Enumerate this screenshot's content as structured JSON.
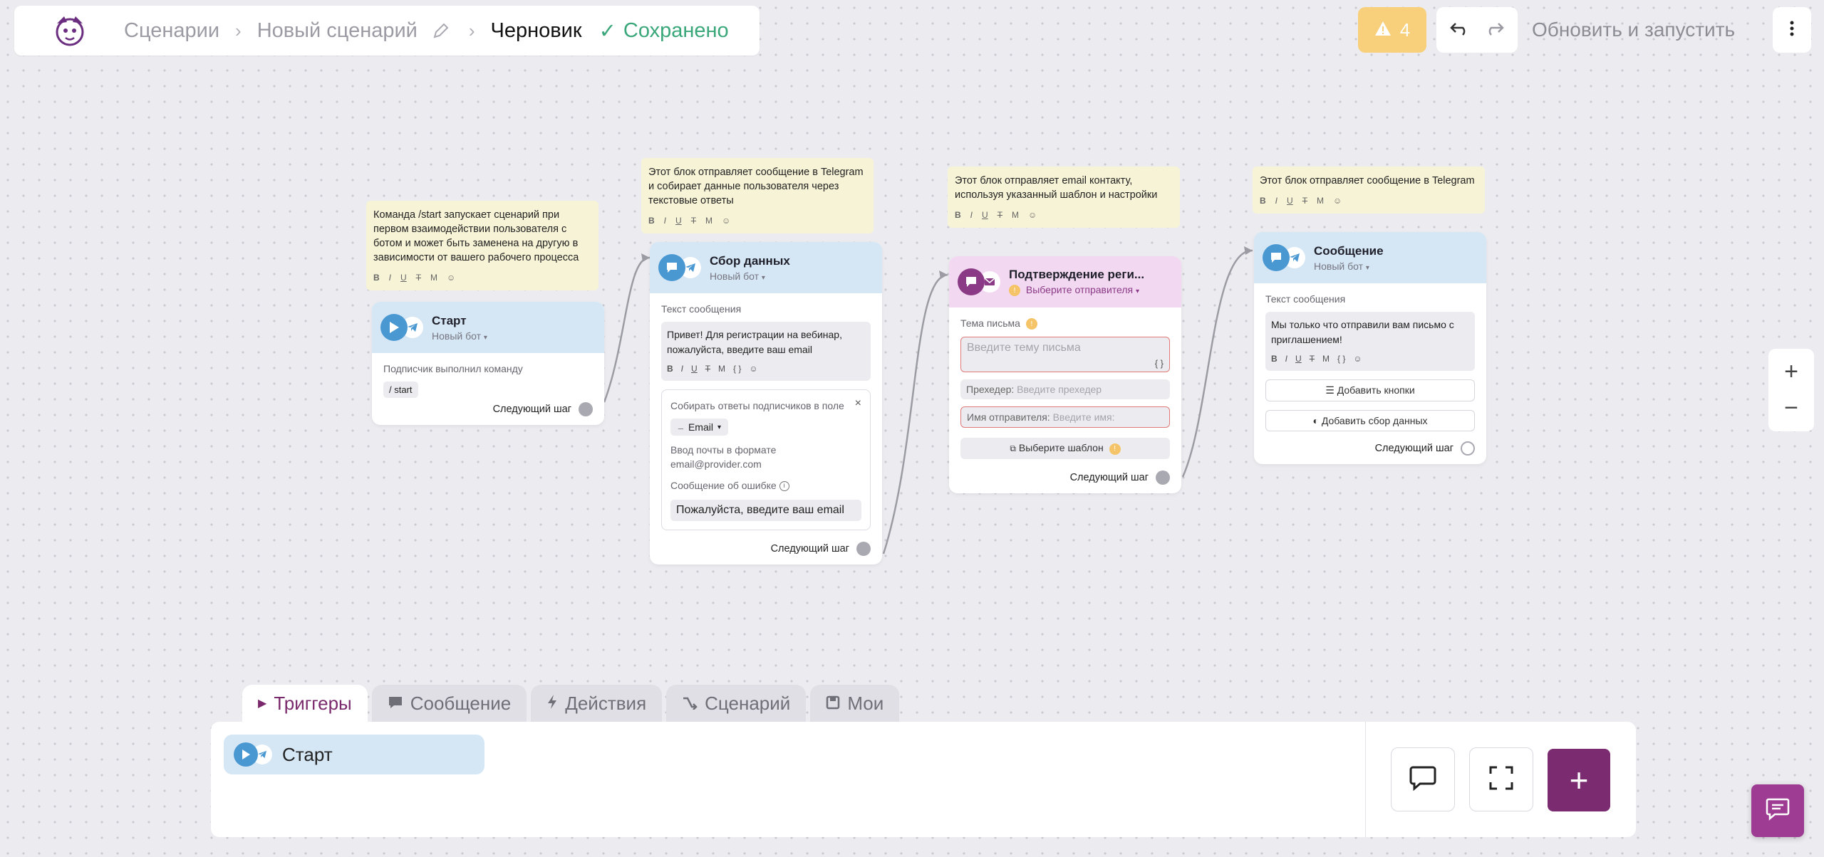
{
  "header": {
    "crumbs": [
      "Сценарии",
      "Новый сценарий"
    ],
    "status": "Черновик",
    "saved": "Сохранено",
    "warnings_count": "4",
    "update_button": "Обновить и запустить"
  },
  "notes": [
    "Команда /start запускает сценарий при первом взаимодействии пользователя с ботом и может быть заменена на другую в зависимости от вашего рабочего процесса",
    "Этот блок отправляет сообщение в Telegram и собирает данные пользователя через текстовые ответы",
    "Этот блок отправляет email контакту, используя указанный шаблон и настройки",
    "Этот блок отправляет сообщение в Telegram"
  ],
  "format_toolbar": [
    "B",
    "I",
    "U",
    "T",
    "M",
    "{ }",
    "☺"
  ],
  "nodes": {
    "start": {
      "title": "Старт",
      "bot": "Новый бот",
      "trigger_label": "Подписчик выполнил команду",
      "command": "/ start",
      "next": "Следующий шаг"
    },
    "collect": {
      "title": "Сбор данных",
      "bot": "Новый бот",
      "msg_label": "Текст сообщения",
      "msg": "Привет! Для регистрации на вебинар, пожалуйста, введите ваш email",
      "collect_label": "Собирать ответы подписчиков в поле",
      "field": "Email",
      "format_hint": "Ввод почты в формате email@provider.com",
      "error_label": "Сообщение об ошибке",
      "error_msg": "Пожалуйста, введите ваш email",
      "next": "Следующий шаг"
    },
    "email": {
      "title": "Подтверждение реги...",
      "sender_select": "Выберите отправителя",
      "subject_label": "Тема письма",
      "subject_placeholder": "Введите тему письма",
      "preheader_label": "Прехедер:",
      "preheader_placeholder": "Введите прехедер",
      "sender_label": "Имя отправителя:",
      "sender_placeholder": "Введите имя:",
      "template_button": "Выберите шаблон",
      "next": "Следующий шаг"
    },
    "message": {
      "title": "Сообщение",
      "bot": "Новый бот",
      "msg_label": "Текст сообщения",
      "msg": "Мы только что отправили вам письмо с приглашением!",
      "add_buttons": "Добавить кнопки",
      "add_collect": "Добавить сбор данных",
      "next": "Следующий шаг"
    }
  },
  "bottom": {
    "tabs": [
      "Триггеры",
      "Сообщение",
      "Действия",
      "Сценарий",
      "Мои"
    ],
    "start_chip": "Старт"
  },
  "colors": {
    "accent": "#7b2b70",
    "saved_green": "#3aa77a",
    "warning": "#f8cf7b",
    "telegram_blue": "#4a98d2"
  }
}
